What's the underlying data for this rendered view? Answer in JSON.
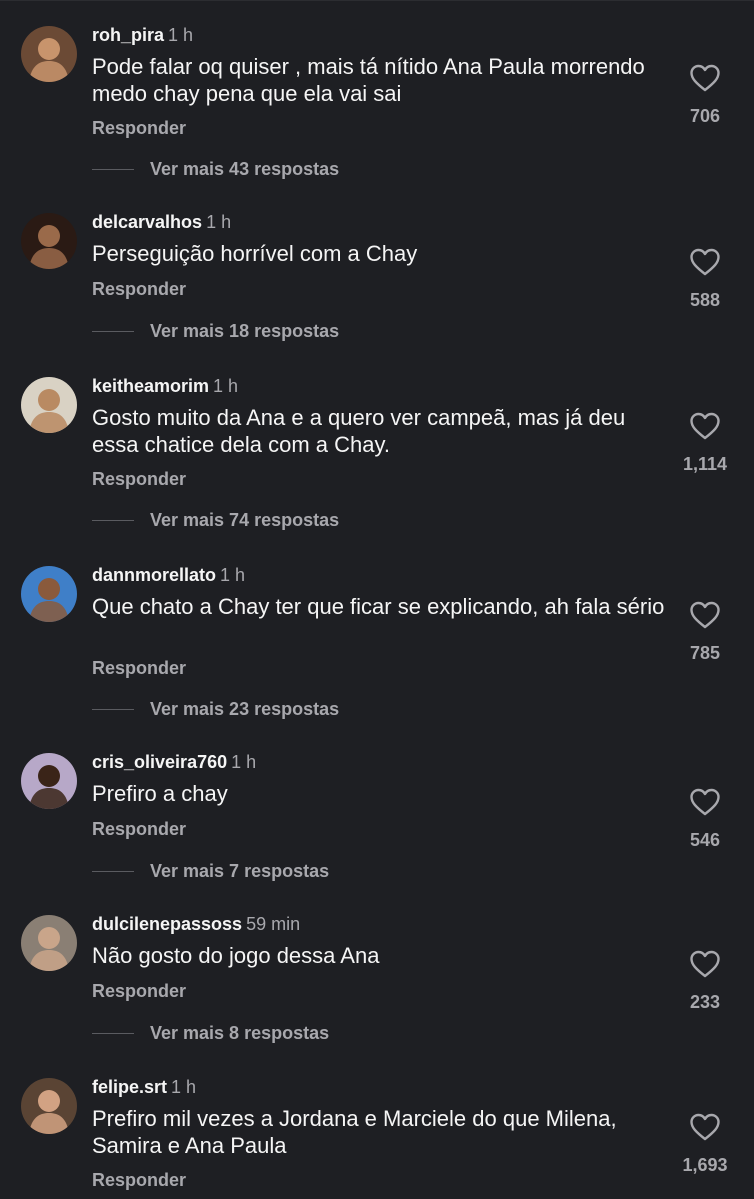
{
  "comments": [
    {
      "username": "roh_pira",
      "time": "1 h",
      "text": "Pode falar oq quiser , mais tá nítido Ana Paula morrendo medo chay pena que ela vai sai",
      "reply_label": "Responder",
      "more_replies": "Ver mais 43 respostas",
      "likes": "706",
      "avatar_colors": [
        "#6b4a35",
        "#c8946c"
      ]
    },
    {
      "username": "delcarvalhos",
      "time": "1 h",
      "text": "Perseguição horrível com a Chay",
      "reply_label": "Responder",
      "more_replies": "Ver mais 18 respostas",
      "likes": "588",
      "avatar_colors": [
        "#2a1a14",
        "#9a6a4a"
      ]
    },
    {
      "username": "keitheamorim",
      "time": "1 h",
      "text": "Gosto muito da Ana e a quero ver campeã, mas já deu essa chatice dela com a Chay.",
      "reply_label": "Responder",
      "more_replies": "Ver mais 74 respostas",
      "likes": "1,114",
      "avatar_colors": [
        "#d9d2c4",
        "#b98a62"
      ]
    },
    {
      "username": "dannmorellato",
      "time": "1 h",
      "text": "Que chato a Chay ter que ficar se explicando, ah fala sério",
      "reply_label": "Responder",
      "more_replies": "Ver mais 23 respostas",
      "likes": "785",
      "avatar_colors": [
        "#3f7fc8",
        "#8a5a3c"
      ]
    },
    {
      "username": "cris_oliveira760",
      "time": "1 h",
      "text": "Prefiro a chay",
      "reply_label": "Responder",
      "more_replies": "Ver mais 7 respostas",
      "likes": "546",
      "avatar_colors": [
        "#b7a8c8",
        "#3a2418"
      ]
    },
    {
      "username": "dulcilenepassoss",
      "time": "59 min",
      "text": "Não gosto do jogo dessa Ana",
      "reply_label": "Responder",
      "more_replies": "Ver mais 8 respostas",
      "likes": "233",
      "avatar_colors": [
        "#8a7f74",
        "#c9a58a"
      ]
    },
    {
      "username": "felipe.srt",
      "time": "1 h",
      "text": "Prefiro mil vezes a Jordana e Marciele do que Milena, Samira e Ana Paula",
      "reply_label": "Responder",
      "more_replies": "",
      "likes": "1,693",
      "avatar_colors": [
        "#5a4434",
        "#d2a283"
      ]
    }
  ],
  "icons": {
    "like": "heart-outline-icon"
  },
  "colors": {
    "background": "#1e1f23",
    "primary_text": "#f5f5f5",
    "secondary_text": "#a8a8ad"
  }
}
